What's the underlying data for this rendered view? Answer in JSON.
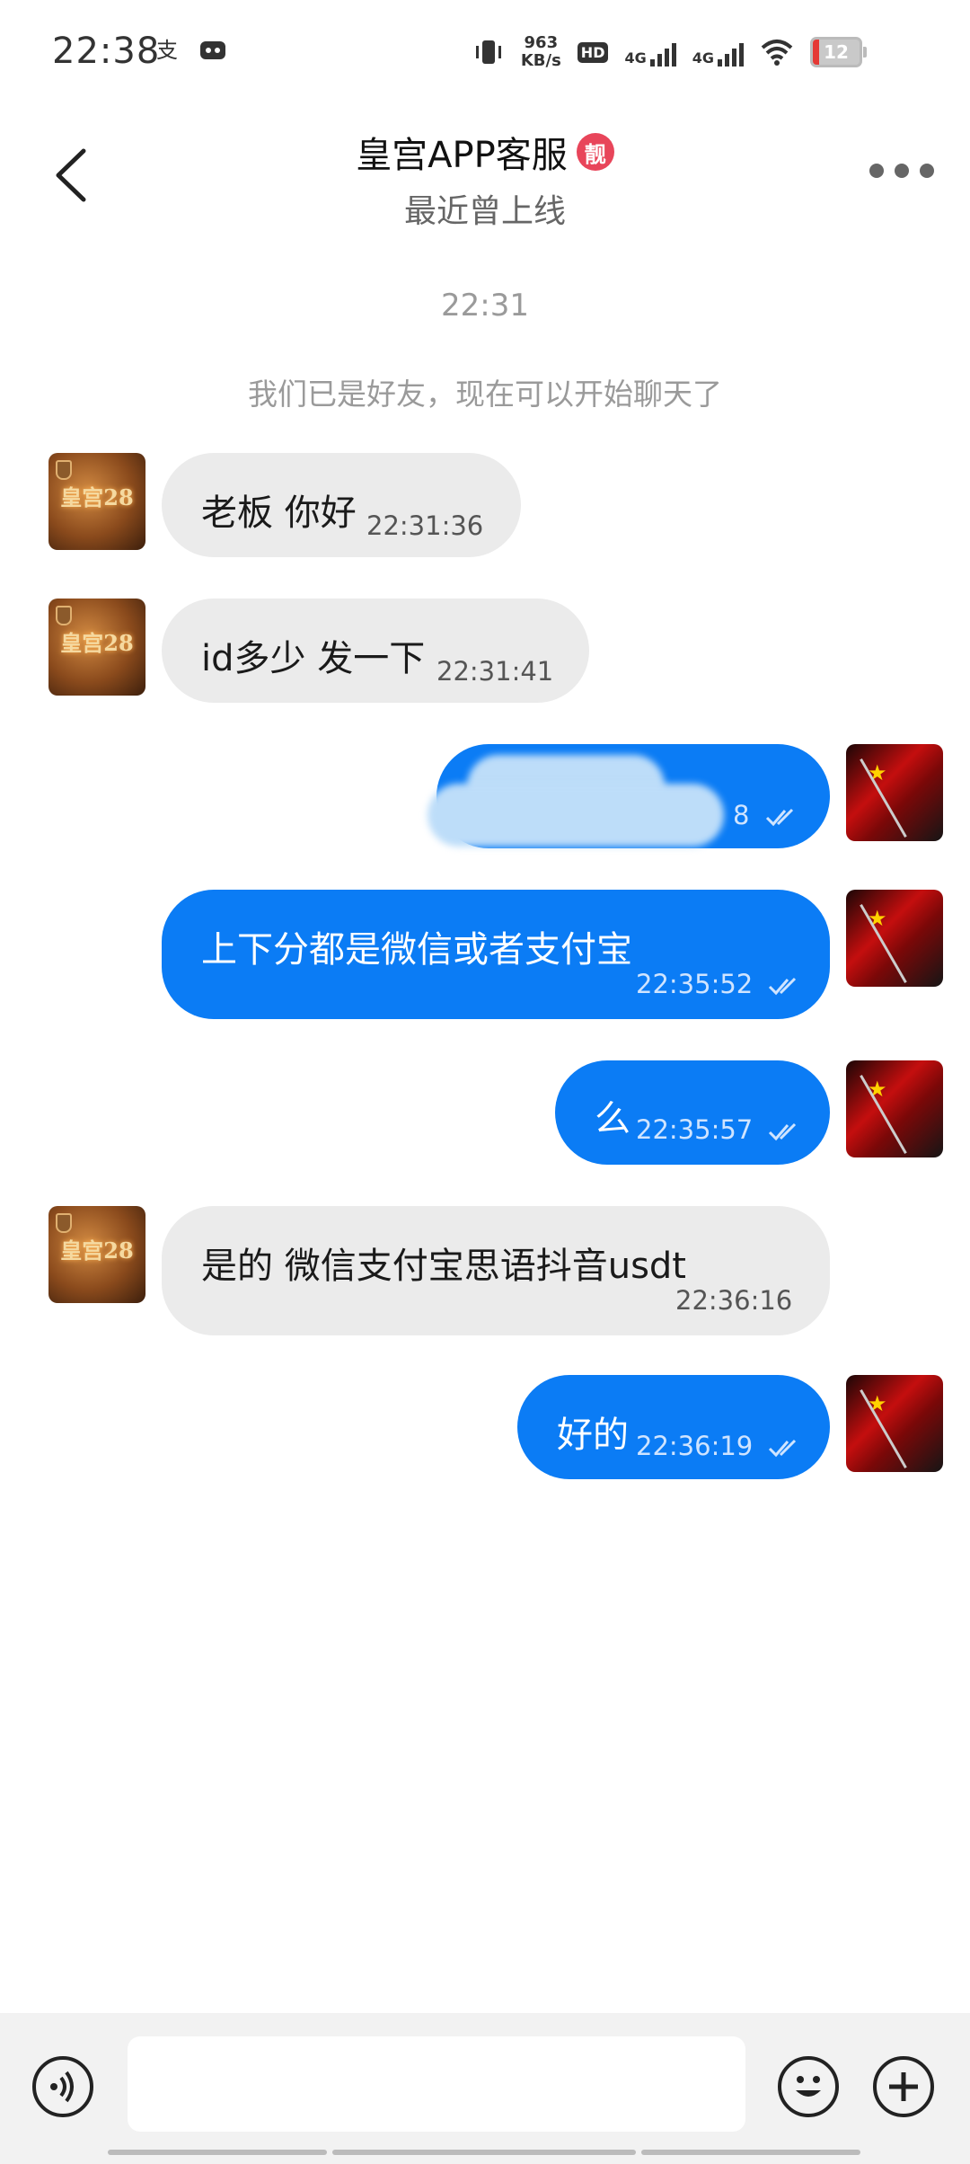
{
  "status_bar": {
    "time": "22:38",
    "speed_value": "963",
    "speed_unit": "KB/s",
    "hd_label": "HD",
    "sim1": "4G",
    "sim2": "4G",
    "battery": "12"
  },
  "header": {
    "title": "皇宫APP客服",
    "badge": "靓",
    "subtitle": "最近曾上线"
  },
  "chat": {
    "timestamp": "22:31",
    "system_message": "我们已是好友，现在可以开始聊天了",
    "messages": [
      {
        "side": "in",
        "text": "老板 你好",
        "time": "22:31:36"
      },
      {
        "side": "in",
        "text": "id多少 发一下",
        "time": "22:31:41"
      },
      {
        "side": "out",
        "text": "",
        "time": "8",
        "redacted": true
      },
      {
        "side": "out",
        "text": "上下分都是微信或者支付宝",
        "time": "22:35:52"
      },
      {
        "side": "out",
        "text": "么",
        "time": "22:35:57"
      },
      {
        "side": "in",
        "text": "是的 微信支付宝思语抖音usdt",
        "time": "22:36:16"
      },
      {
        "side": "out",
        "text": "好的",
        "time": "22:36:19"
      }
    ],
    "left_avatar_text": "皇宫28"
  },
  "colors": {
    "outgoing_bubble": "#0b7cf5",
    "incoming_bubble": "#ebebeb",
    "badge": "#e8455a"
  },
  "icons": [
    "back-arrow-icon",
    "more-icon",
    "voice-icon",
    "emoji-icon",
    "plus-icon",
    "read-check-icon"
  ]
}
